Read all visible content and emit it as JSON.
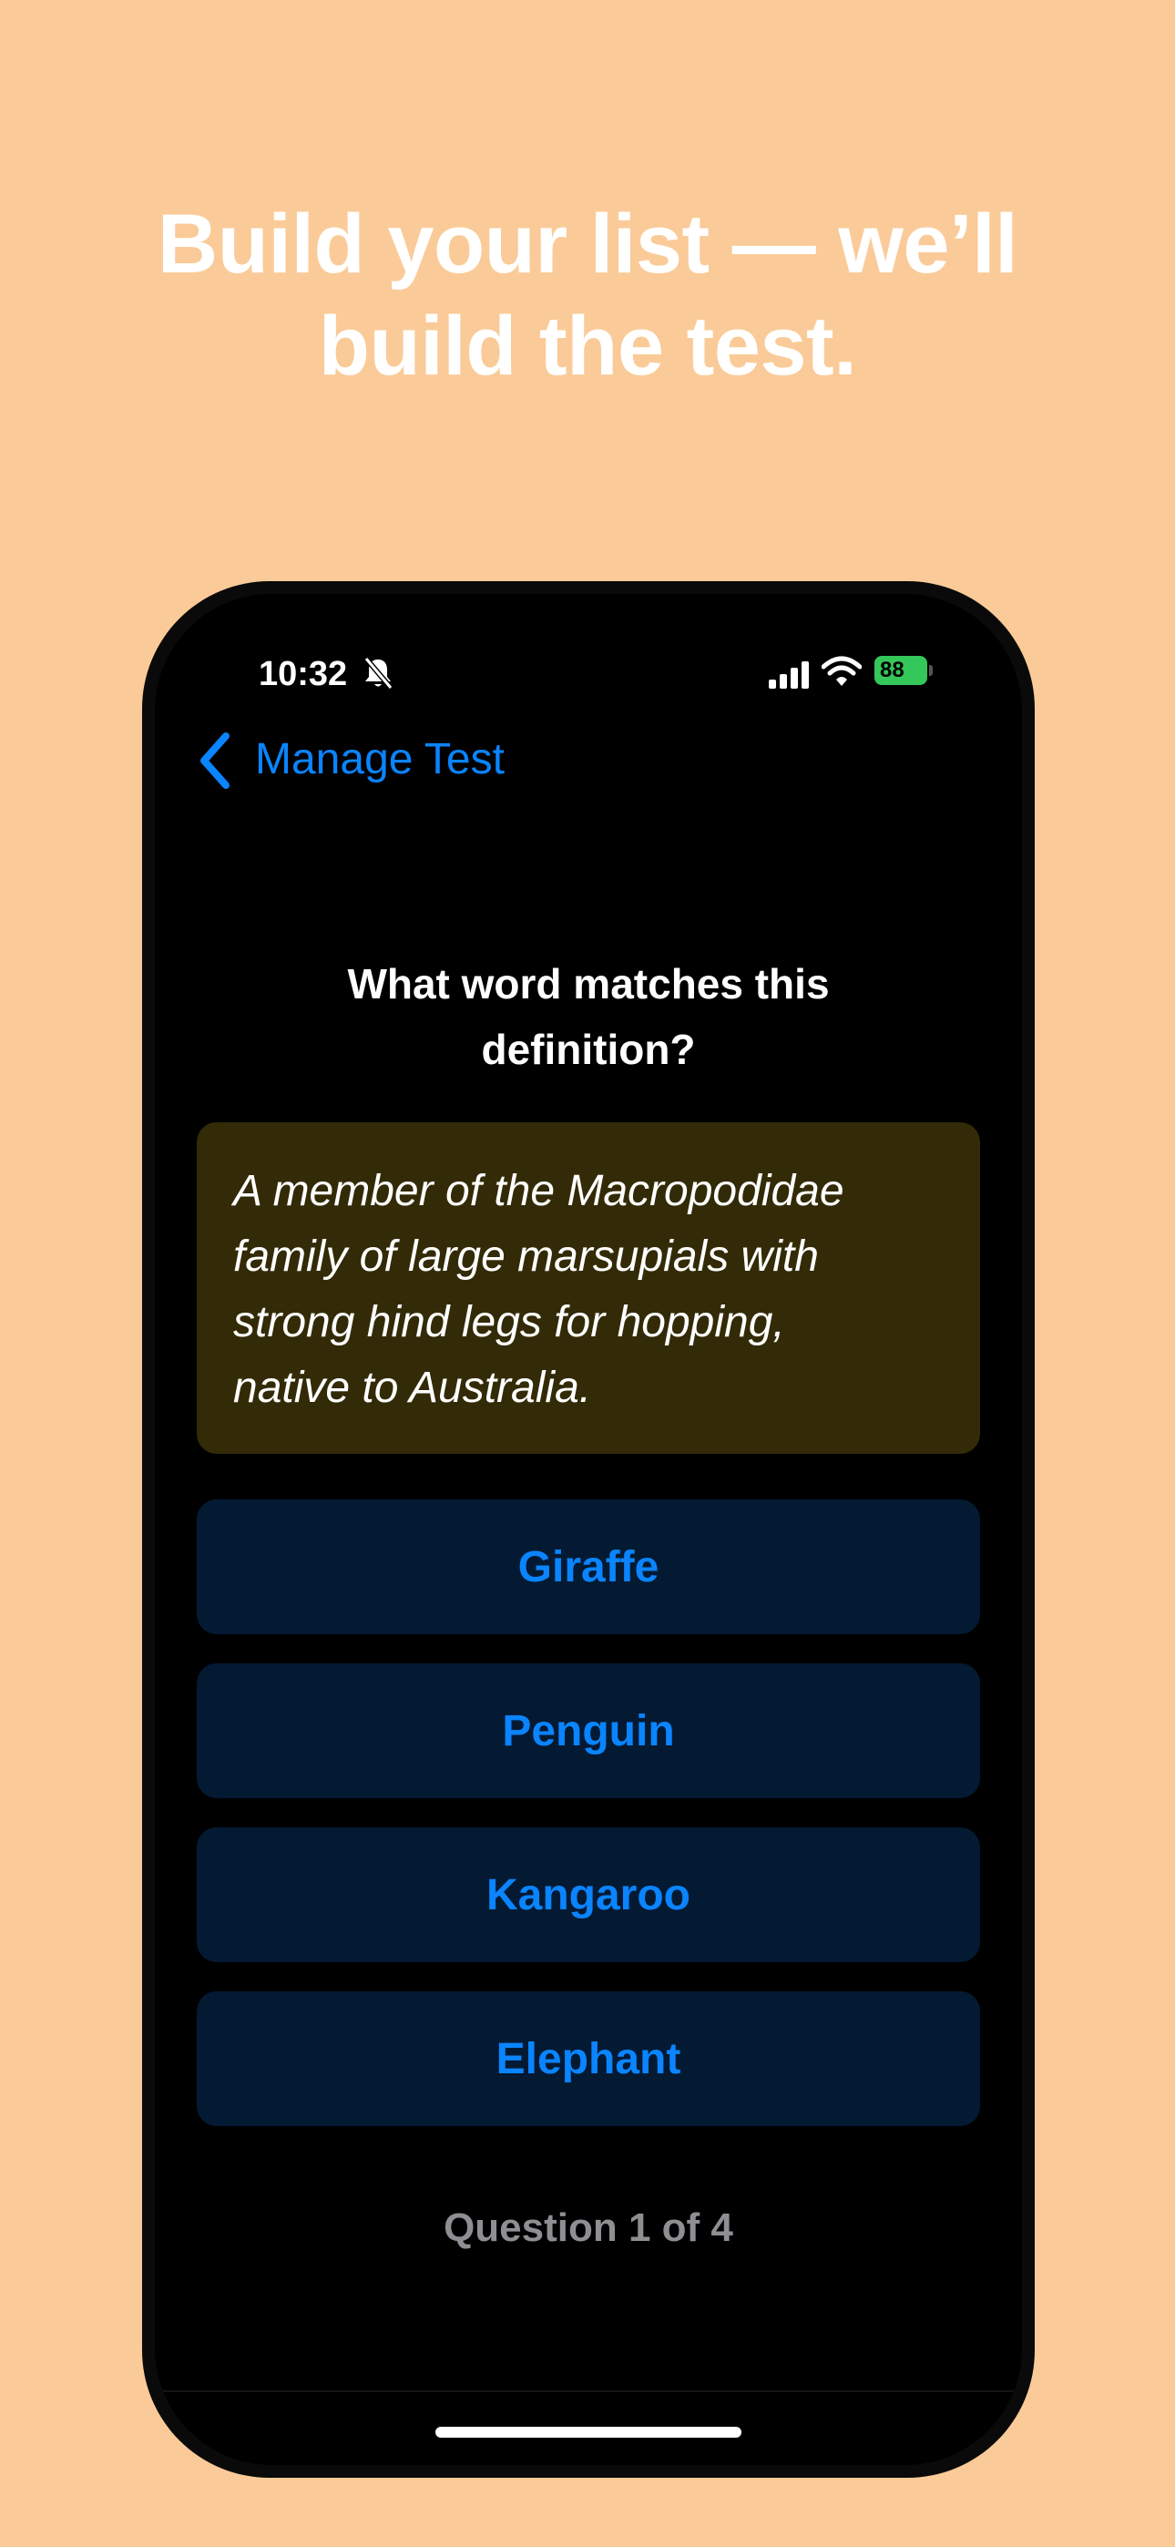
{
  "headline": {
    "line1": "Build your list — we’ll",
    "line2": "build the test."
  },
  "status_bar": {
    "time": "10:32",
    "battery_level": "88",
    "icons": [
      "bell-slash-icon",
      "signal-icon",
      "wifi-icon",
      "battery-icon"
    ],
    "battery_color": "#34C759"
  },
  "nav": {
    "back_label": "Manage Test",
    "back_icon": "chevron-left-icon",
    "accent_color": "#0A84FF"
  },
  "quiz": {
    "question_line1": "What word matches this",
    "question_line2": "definition?",
    "definition_lines": [
      "A member of the Macropodidae",
      "family of large marsupials with",
      "strong hind legs for hopping,",
      "native to Australia."
    ],
    "answers": [
      "Giraffe",
      "Penguin",
      "Kangaroo",
      "Elephant"
    ],
    "progress": "Question 1 of 4"
  },
  "colors": {
    "background": "#FACB98",
    "definition_card": "#332B07",
    "answer_button": "#041A33",
    "progress_text": "#8E8E93"
  }
}
